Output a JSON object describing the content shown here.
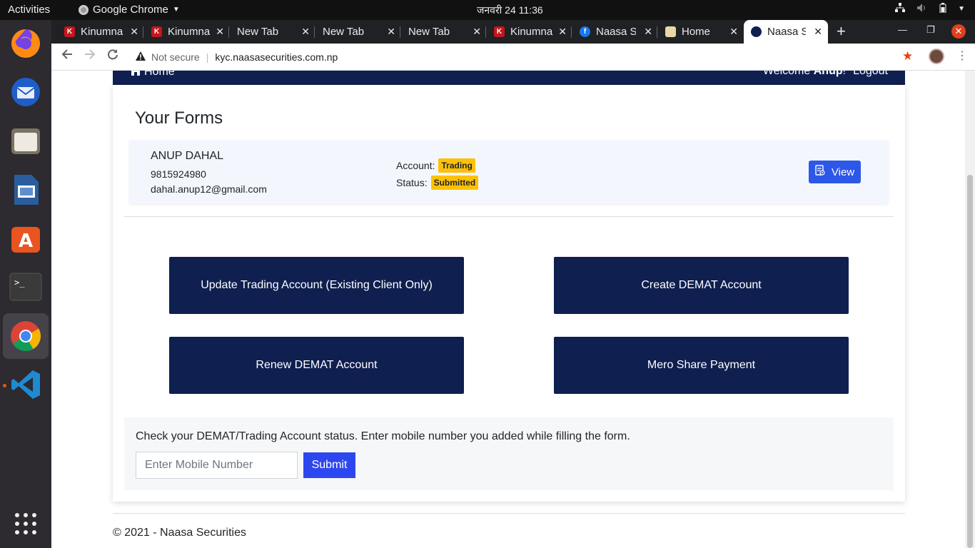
{
  "system": {
    "activities": "Activities",
    "app_name": "Google Chrome",
    "clock": "जनवरी 24  11:36"
  },
  "dock": {
    "items": [
      "firefox-icon",
      "thunderbird-icon",
      "files-icon",
      "libreoffice-impress-icon",
      "software-center-icon",
      "terminal-icon",
      "chrome-icon",
      "vscode-icon",
      "app-grid-icon"
    ]
  },
  "browser": {
    "tabs": [
      {
        "label": "Kinumna",
        "favicon": "K"
      },
      {
        "label": "Kinumna",
        "favicon": "K"
      },
      {
        "label": "New Tab",
        "favicon": ""
      },
      {
        "label": "New Tab",
        "favicon": ""
      },
      {
        "label": "New Tab",
        "favicon": ""
      },
      {
        "label": "Kinumna",
        "favicon": "K"
      },
      {
        "label": "Naasa Se",
        "favicon": "f"
      },
      {
        "label": "Home",
        "favicon": ""
      },
      {
        "label": "Naasa Se",
        "favicon": ""
      }
    ],
    "security": "Not secure",
    "url": "kyc.naasasecurities.com.np"
  },
  "navbar": {
    "home": "Home",
    "welcome": "Welcome ",
    "user": "Anup",
    "logout": "Logout"
  },
  "page": {
    "title": "Your Forms",
    "form": {
      "name": "ANUP DAHAL",
      "phone": "9815924980",
      "email": "dahal.anup12@gmail.com",
      "account_label": "Account:",
      "account_value": "Trading",
      "status_label": "Status:",
      "status_value": "Submitted",
      "view_label": "View"
    },
    "actions": {
      "update_trading": "Update Trading Account (Existing Client Only)",
      "create_demat": "Create DEMAT Account",
      "renew_demat": "Renew DEMAT Account",
      "mero_share": "Mero Share Payment"
    },
    "status_check": {
      "text": "Check your DEMAT/Trading Account status. Enter mobile number you added while filling the form.",
      "placeholder": "Enter Mobile Number",
      "submit": "Submit"
    },
    "footer": "© 2021 - Naasa Securities"
  }
}
